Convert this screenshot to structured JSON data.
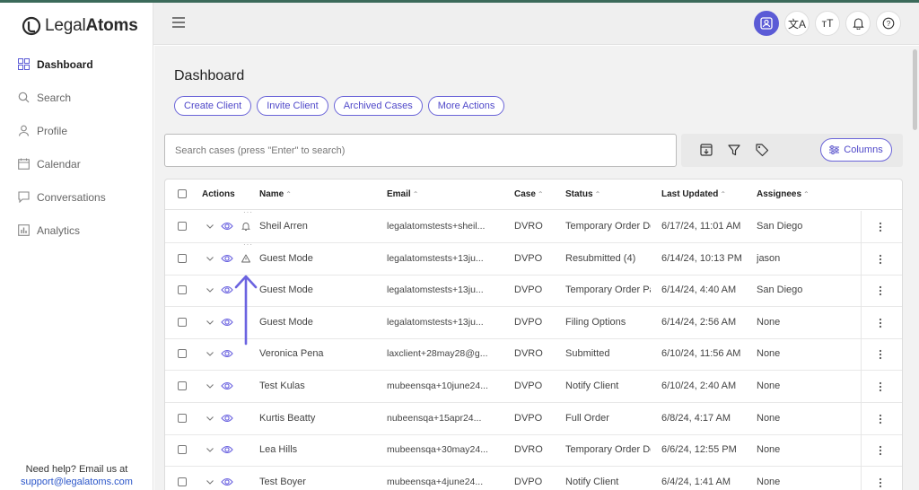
{
  "brand": {
    "name_light": "Legal",
    "name_bold": "Atoms"
  },
  "sidebar": {
    "items": [
      {
        "label": "Dashboard",
        "icon": "grid-icon",
        "active": true
      },
      {
        "label": "Search",
        "icon": "search-icon"
      },
      {
        "label": "Profile",
        "icon": "user-icon"
      },
      {
        "label": "Calendar",
        "icon": "calendar-icon"
      },
      {
        "label": "Conversations",
        "icon": "chat-icon"
      },
      {
        "label": "Analytics",
        "icon": "chart-icon"
      }
    ],
    "help_text": "Need help? Email us at",
    "help_email": "support@legalatoms.com"
  },
  "topbar": {
    "icons": [
      "profile-card-icon",
      "translate-icon",
      "text-size-icon",
      "bell-icon",
      "help-icon"
    ],
    "translate_glyph": "文A",
    "text_size_glyph": "тT",
    "help_glyph": "?"
  },
  "page": {
    "title": "Dashboard",
    "buttons": [
      "Create Client",
      "Invite Client",
      "Archived Cases",
      "More Actions"
    ]
  },
  "search": {
    "placeholder": "Search cases (press \"Enter\" to search)"
  },
  "toolbar": {
    "columns_label": "Columns"
  },
  "table": {
    "headers": [
      "Actions",
      "Name",
      "Email",
      "Case",
      "Status",
      "Last Updated",
      "Assignees"
    ],
    "sort_glyph": "⌃",
    "rows": [
      {
        "name": "Sheil Arren",
        "email": "legalatomstests+sheil...",
        "case": "DVRO",
        "status": "Temporary Order Do",
        "updated": "6/17/24, 11:01 AM",
        "assignee": "San Diego",
        "marker": "bell",
        "dots": true
      },
      {
        "name": "Guest Mode",
        "email": "legalatomstests+13ju...",
        "case": "DVPO",
        "status": "Resubmitted (4)",
        "updated": "6/14/24, 10:13 PM",
        "assignee": "jason",
        "marker": "warning",
        "dots": true
      },
      {
        "name": "Guest Mode",
        "email": "legalatomstests+13ju...",
        "case": "DVPO",
        "status": "Temporary Order Pa",
        "updated": "6/14/24, 4:40 AM",
        "assignee": "San Diego",
        "marker": "",
        "dots": false
      },
      {
        "name": "Guest Mode",
        "email": "legalatomstests+13ju...",
        "case": "DVPO",
        "status": "Filing Options",
        "updated": "6/14/24, 2:56 AM",
        "assignee": "None",
        "marker": "",
        "dots": false
      },
      {
        "name": "Veronica Pena",
        "email": "laxclient+28may28@g...",
        "case": "DVRO",
        "status": "Submitted",
        "updated": "6/10/24, 11:56 AM",
        "assignee": "None",
        "marker": "",
        "dots": false
      },
      {
        "name": "Test Kulas",
        "email": "mubeensqa+10june24...",
        "case": "DVPO",
        "status": "Notify Client",
        "updated": "6/10/24, 2:40 AM",
        "assignee": "None",
        "marker": "",
        "dots": false
      },
      {
        "name": "Kurtis Beatty",
        "email": "nubeensqa+15apr24...",
        "case": "DVPO",
        "status": "Full Order",
        "updated": "6/8/24, 4:17 AM",
        "assignee": "None",
        "marker": "",
        "dots": false
      },
      {
        "name": "Lea Hills",
        "email": "mubeensqa+30may24...",
        "case": "DVRO",
        "status": "Temporary Order Do",
        "updated": "6/6/24, 12:55 PM",
        "assignee": "None",
        "marker": "",
        "dots": false
      },
      {
        "name": "Test Boyer",
        "email": "mubeensqa+4june24...",
        "case": "DVPO",
        "status": "Notify Client",
        "updated": "6/4/24, 1:41 AM",
        "assignee": "None",
        "marker": "",
        "dots": false
      }
    ]
  },
  "colors": {
    "accent": "#5b5bd6",
    "annotation": "#6b63e0"
  }
}
